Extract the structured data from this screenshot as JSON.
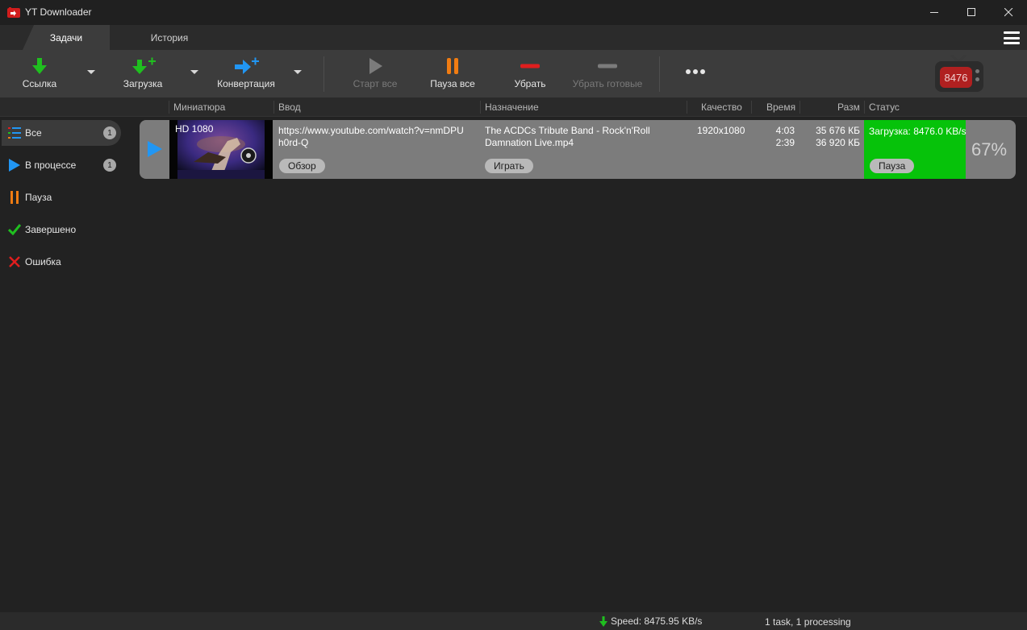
{
  "window": {
    "title": "YT Downloader",
    "controls": [
      "minimize",
      "maximize",
      "close"
    ]
  },
  "tabs": [
    {
      "label": "Задачи",
      "active": true
    },
    {
      "label": "История",
      "active": false
    }
  ],
  "toolbar": {
    "link_label": "Ссылка",
    "download_label": "Загрузка",
    "convert_label": "Конвертация",
    "start_all_label": "Старт все",
    "pause_all_label": "Пауза все",
    "remove_label": "Убрать",
    "remove_done_label": "Убрать готовые",
    "tv_counter": "8476"
  },
  "columns": {
    "thumbnail": "Миниатюра",
    "input": "Ввод",
    "destination": "Назначение",
    "quality": "Качество",
    "time": "Время",
    "size": "Разм",
    "status": "Статус"
  },
  "sidebar": {
    "items": [
      {
        "label": "Все",
        "count": "1",
        "icon": "list-icon",
        "active": true
      },
      {
        "label": "В процессе",
        "count": "1",
        "icon": "play-icon",
        "active": false
      },
      {
        "label": "Пауза",
        "count": "",
        "icon": "pause-icon",
        "active": false
      },
      {
        "label": "Завершено",
        "count": "",
        "icon": "check-icon",
        "active": false
      },
      {
        "label": "Ошибка",
        "count": "",
        "icon": "x-icon",
        "active": false
      }
    ]
  },
  "task": {
    "thumb_label": "HD 1080",
    "url_line1": "https://www.youtube.com/watch?v=nmDPU",
    "url_line2": "h0rd-Q",
    "browse_label": "Обзор",
    "file_line1": "The ACDCs Tribute Band - Rock'n'Roll",
    "file_line2": "Damnation Live.mp4",
    "play_label": "Играть",
    "quality": "1920x1080",
    "time_total": "4:03",
    "time_left": "2:39",
    "size_total": "35 676 КБ",
    "size_done": "36 920 КБ",
    "status_text": "Загрузка: 8476.0 KB/s",
    "pause_label": "Пауза",
    "percent": "67%",
    "status_color": "#06c20a"
  },
  "statusbar": {
    "speed": "Speed: 8475.95 KB/s",
    "tasks": "1 task, 1 processing"
  },
  "colors": {
    "accent_green": "#1fbf1f",
    "accent_blue": "#2196f3",
    "accent_orange": "#f07c12",
    "accent_red": "#e01e1e"
  }
}
